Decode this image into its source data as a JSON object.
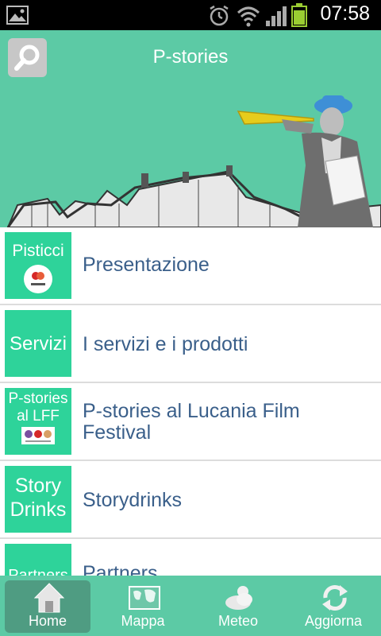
{
  "status_bar": {
    "time": "07:58"
  },
  "app_bar": {
    "title": "P-stories"
  },
  "menu": [
    {
      "tile_text": "Pisticci",
      "label": "Presentazione"
    },
    {
      "tile_text": "Servizi",
      "label": "I servizi e i prodotti"
    },
    {
      "tile_line1": "P-stories",
      "tile_line2": "al LFF",
      "label": "P-stories al Lucania Film Festival"
    },
    {
      "tile_line1": "Story",
      "tile_line2": "Drinks",
      "label": "Storydrinks"
    },
    {
      "tile_text": "Partners",
      "label": "Partners"
    }
  ],
  "tabs": [
    {
      "label": "Home",
      "icon": "home-icon",
      "active": true
    },
    {
      "label": "Mappa",
      "icon": "map-icon",
      "active": false
    },
    {
      "label": "Meteo",
      "icon": "weather-icon",
      "active": false
    },
    {
      "label": "Aggiorna",
      "icon": "refresh-icon",
      "active": false
    }
  ],
  "colors": {
    "accent": "#5ccaa5",
    "tile": "#2ed39a",
    "label": "#3a5f8a",
    "active_tab": "#4f9c82"
  }
}
